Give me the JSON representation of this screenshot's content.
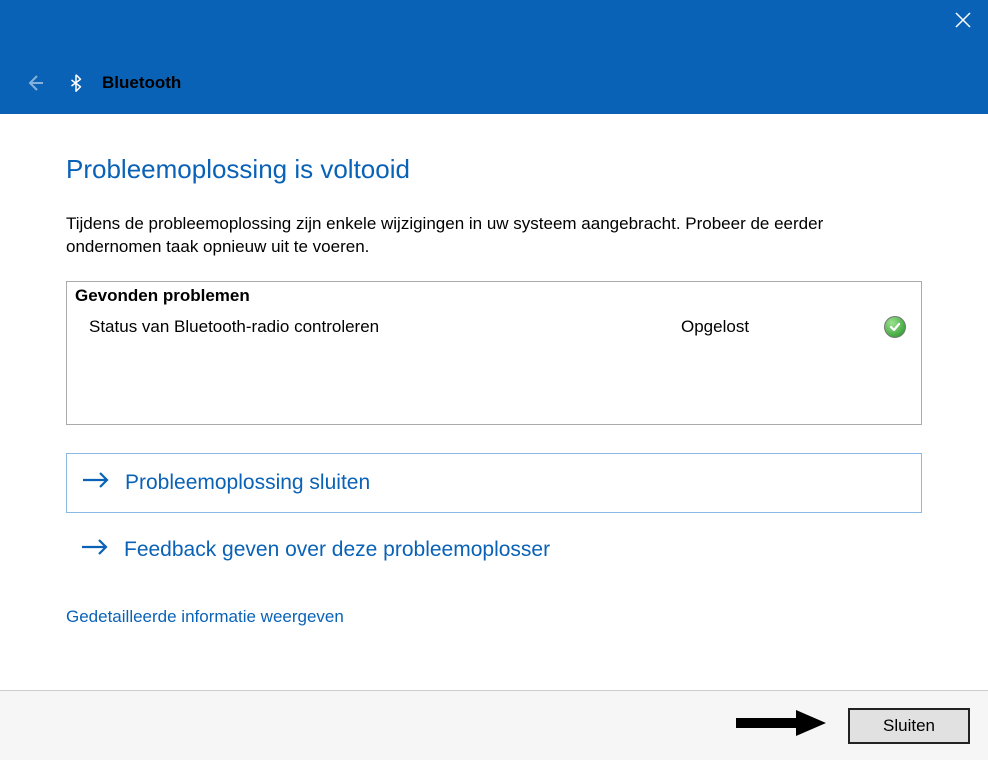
{
  "header": {
    "title": "Bluetooth"
  },
  "main": {
    "heading": "Probleemoplossing is voltooid",
    "description": "Tijdens de probleemoplossing zijn enkele wijzigingen in uw systeem aangebracht. Probeer de eerder ondernomen taak opnieuw uit te voeren."
  },
  "problems": {
    "header": "Gevonden problemen",
    "items": [
      {
        "name": "Status van Bluetooth-radio controleren",
        "status": "Opgelost"
      }
    ]
  },
  "actions": {
    "close_troubleshooter": "Probleemoplossing sluiten",
    "give_feedback": "Feedback geven over deze probleemoplosser"
  },
  "links": {
    "detailed_info": "Gedetailleerde informatie weergeven"
  },
  "footer": {
    "close_button": "Sluiten"
  }
}
